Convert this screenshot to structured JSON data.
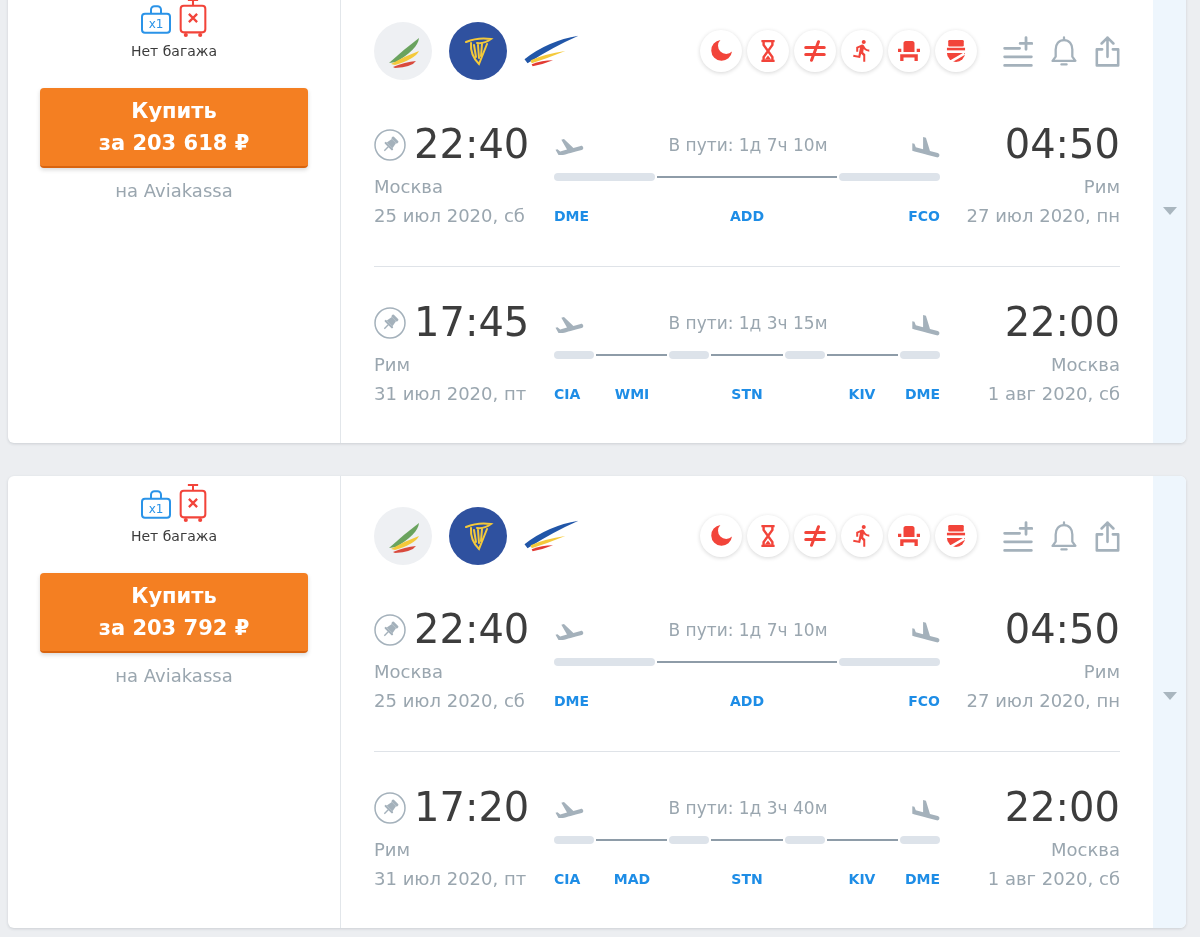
{
  "offers": [
    {
      "baggage": {
        "bag_count": "x1",
        "label": "Нет багажа"
      },
      "buy_button": {
        "label": "Купить",
        "price": "за 203 618 ₽"
      },
      "seller": "на Aviakassa",
      "expanded": false,
      "flights": [
        {
          "departure": {
            "time": "22:40",
            "city": "Москва",
            "date": "25 июл 2020, сб"
          },
          "duration": "В пути: 1д 7ч 10м",
          "origin_code": "DME",
          "segments": [
            {
              "kind": "flight"
            },
            {
              "kind": "layover",
              "code": "ADD"
            },
            {
              "kind": "flight"
            }
          ],
          "destination_code": "FCO",
          "arrival": {
            "time": "04:50",
            "city": "Рим",
            "date": "27 июл 2020, пн"
          }
        },
        {
          "departure": {
            "time": "17:45",
            "city": "Рим",
            "date": "31 июл 2020, пт"
          },
          "duration": "В пути: 1д 3ч 15м",
          "origin_code": "CIA",
          "segments": [
            {
              "kind": "flight"
            },
            {
              "kind": "layover",
              "code": "WMI"
            },
            {
              "kind": "flight"
            },
            {
              "kind": "layover",
              "code": "STN"
            },
            {
              "kind": "flight"
            },
            {
              "kind": "layover",
              "code": "KIV"
            },
            {
              "kind": "flight"
            }
          ],
          "destination_code": "DME",
          "arrival": {
            "time": "22:00",
            "city": "Москва",
            "date": "1 авг 2020, сб"
          }
        }
      ]
    },
    {
      "baggage": {
        "bag_count": "x1",
        "label": "Нет багажа"
      },
      "buy_button": {
        "label": "Купить",
        "price": "за 203 792 ₽"
      },
      "seller": "на Aviakassa",
      "expanded": false,
      "flights": [
        {
          "departure": {
            "time": "22:40",
            "city": "Москва",
            "date": "25 июл 2020, сб"
          },
          "duration": "В пути: 1д 7ч 10м",
          "origin_code": "DME",
          "segments": [
            {
              "kind": "flight"
            },
            {
              "kind": "layover",
              "code": "ADD"
            },
            {
              "kind": "flight"
            }
          ],
          "destination_code": "FCO",
          "arrival": {
            "time": "04:50",
            "city": "Рим",
            "date": "27 июл 2020, пн"
          }
        },
        {
          "departure": {
            "time": "17:20",
            "city": "Рим",
            "date": "31 июл 2020, пт"
          },
          "duration": "В пути: 1д 3ч 40м",
          "origin_code": "CIA",
          "segments": [
            {
              "kind": "flight"
            },
            {
              "kind": "layover",
              "code": "MAD"
            },
            {
              "kind": "flight"
            },
            {
              "kind": "layover",
              "code": "STN"
            },
            {
              "kind": "flight"
            },
            {
              "kind": "layover",
              "code": "KIV"
            },
            {
              "kind": "flight"
            }
          ],
          "destination_code": "DME",
          "arrival": {
            "time": "22:00",
            "city": "Москва",
            "date": "1 авг 2020, сб"
          }
        }
      ]
    }
  ]
}
